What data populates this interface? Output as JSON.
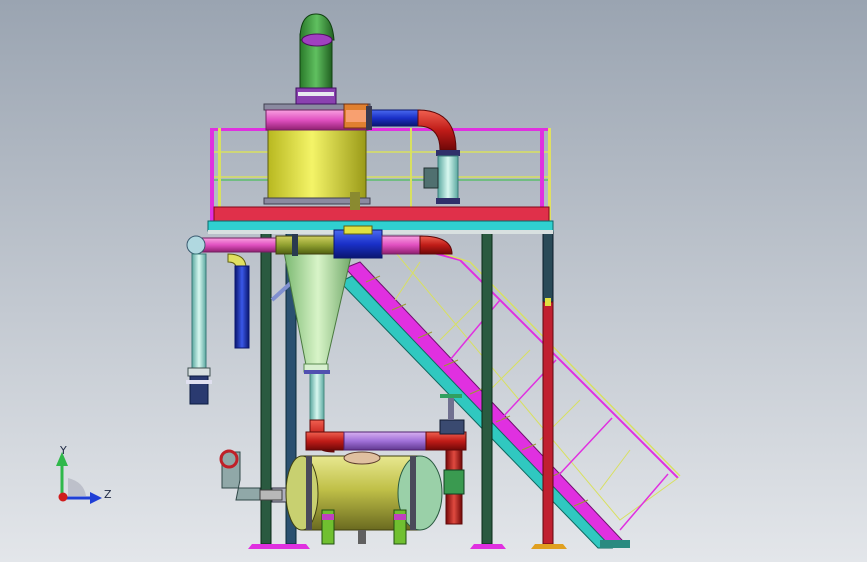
{
  "viewport": {
    "background_top": "#9aa4b1",
    "background_bottom": "#e3e6ea"
  },
  "triad": {
    "y_label": "Y",
    "z_label": "Z",
    "y_color": "#2fb84a",
    "z_color": "#1f3fd6",
    "x_color": "#d01c1c"
  },
  "model_colors": {
    "separator_body": "#e8e840",
    "top_ring": "#e85ab0",
    "exhaust_pipe": "#3a9a3a",
    "exhaust_opening": "#a040c0",
    "platform_deck": "#e0304a",
    "platform_beam": "#30d0d0",
    "railing_magenta": "#e030e0",
    "railing_yellow": "#d8e060",
    "cyclone_cone": "#a8e0a0",
    "column_dark": "#2a5a40",
    "column_red": "#c02030",
    "column_blue": "#2050c0",
    "pipe_red": "#c8201c",
    "pipe_blue": "#1a3ad0",
    "pipe_cyan": "#8ad8d0",
    "tank_body": "#c8c860",
    "tank_head": "#9ad0a0",
    "stair_magenta": "#e030e0",
    "stair_cyan": "#30c0b8"
  }
}
